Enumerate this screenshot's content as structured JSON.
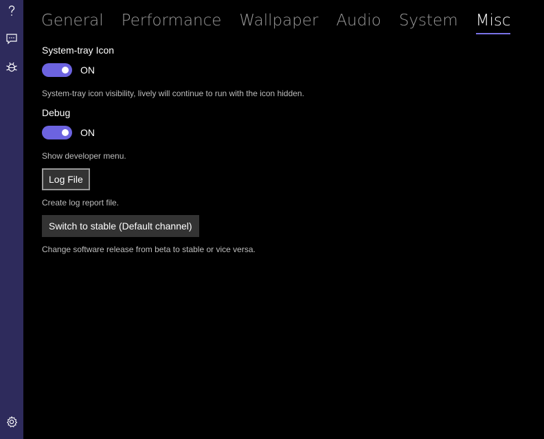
{
  "colors": {
    "sidebar_bg": "#2e2b5c",
    "accent": "#6c63e0",
    "background": "#000000"
  },
  "sidebar": {
    "top_icons": [
      "help-icon",
      "feedback-icon",
      "bug-icon"
    ],
    "bottom_icons": [
      "settings-icon"
    ]
  },
  "tabs": [
    {
      "label": "General",
      "active": false
    },
    {
      "label": "Performance",
      "active": false
    },
    {
      "label": "Wallpaper",
      "active": false
    },
    {
      "label": "Audio",
      "active": false
    },
    {
      "label": "System",
      "active": false
    },
    {
      "label": "Misc",
      "active": true
    }
  ],
  "systray": {
    "title": "System-tray Icon",
    "state": "ON",
    "description": "System-tray icon visibility, lively will continue to run with the icon hidden."
  },
  "debug": {
    "title": "Debug",
    "state": "ON",
    "description": "Show developer menu."
  },
  "log": {
    "button_label": "Log File",
    "description": "Create log report file."
  },
  "channel": {
    "button_label": "Switch to stable (Default channel)",
    "description": "Change software release from beta to stable or vice versa."
  }
}
